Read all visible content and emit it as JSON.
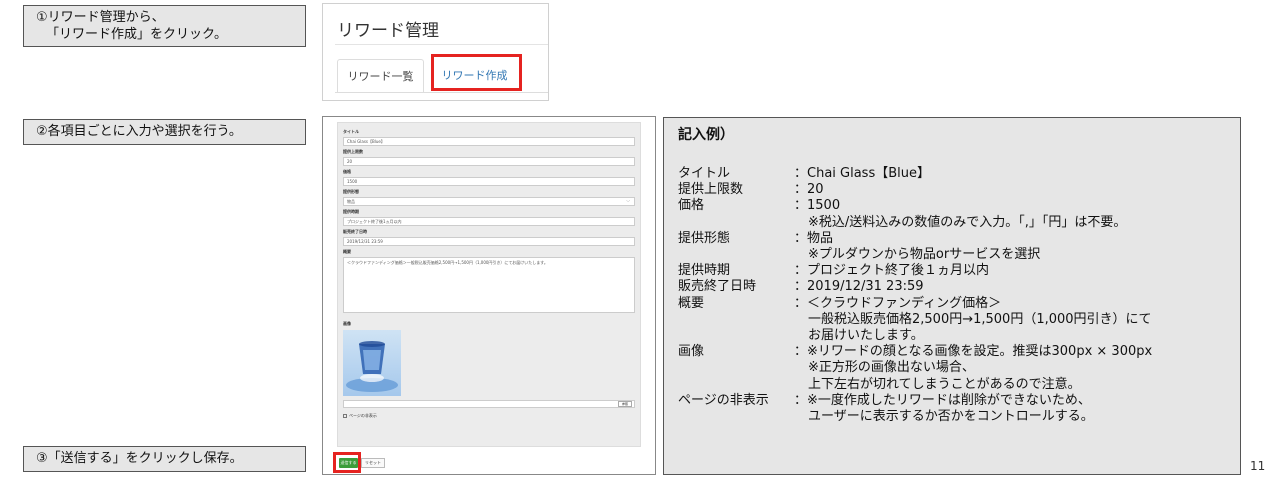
{
  "steps": {
    "step1_line1": "①リワード管理から、",
    "step1_line2": "「リワード作成」をクリック。",
    "step2": "②各項目ごとに入力や選択を行う。",
    "step3": "③「送信する」をクリックし保存。"
  },
  "reward_admin": {
    "title": "リワード管理",
    "tab_list": "リワード一覧",
    "tab_create": "リワード作成"
  },
  "form": {
    "title_label": "タイトル",
    "title_value": "Chai Glass【Blue】",
    "limit_label": "提供上限数",
    "limit_value": "20",
    "price_label": "価格",
    "price_value": "1500",
    "type_label": "提供形態",
    "type_value": "物品",
    "period_label": "提供時期",
    "period_value": "プロジェクト終了後1ヵ月以内",
    "end_label": "販売終了日時",
    "end_value": "2019/12/31 23:59",
    "summary_label": "概要",
    "summary_value": "＜クラウドファンディング価格＞一般税込販売価格2,500円→1,500円（1,000円引き）にてお届けいたします。",
    "image_label": "画像",
    "file_button": "参照",
    "hide_label": "ページの非表示",
    "submit_label": "送信する",
    "reset_label": "リセット"
  },
  "example": {
    "heading": "記入例）",
    "rows": [
      {
        "key": "タイトル",
        "value": "：Chai Glass【Blue】"
      },
      {
        "key": "提供上限数",
        "value": "：20"
      },
      {
        "key": "価格",
        "value": "：1500"
      },
      {
        "key": "",
        "value": "※税込/送料込みの数値のみで入力。「,」「円」は不要。"
      },
      {
        "key": "提供形態",
        "value": "：物品"
      },
      {
        "key": "",
        "value": "※プルダウンから物品orサービスを選択"
      },
      {
        "key": "提供時期",
        "value": "：プロジェクト終了後１ヵ月以内"
      },
      {
        "key": "販売終了日時",
        "value": "：2019/12/31 23:59"
      },
      {
        "key": "概要",
        "value": "：＜クラウドファンディング価格＞"
      },
      {
        "key": "",
        "value": "一般税込販売価格2,500円→1,500円（1,000円引き）にて"
      },
      {
        "key": "",
        "value": "お届けいたします。"
      },
      {
        "key": "画像",
        "value": "：※リワードの顔となる画像を設定。推奨は300px × 300px"
      },
      {
        "key": "",
        "value": "※正方形の画像出ない場合、"
      },
      {
        "key": "",
        "value": "上下左右が切れてしまうことがあるので注意。"
      },
      {
        "key": "ページの非表示",
        "value": "：※一度作成したリワードは削除ができないため、"
      },
      {
        "key": "",
        "value": "ユーザーに表示するか否かをコントロールする。"
      }
    ]
  },
  "page_number": "11",
  "colors": {
    "highlight": "#e52320",
    "tab_active": "#3277b3",
    "submit": "#3b9d3b"
  }
}
